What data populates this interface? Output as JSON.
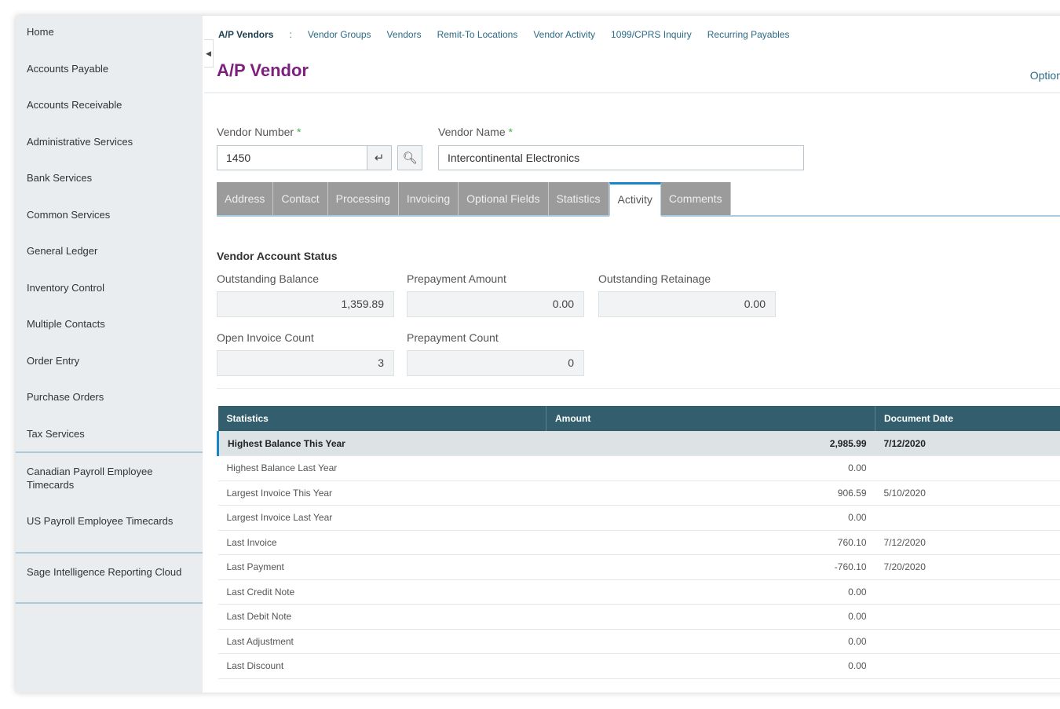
{
  "sidebar": {
    "items": [
      "Home",
      "Accounts Payable",
      "Accounts Receivable",
      "Administrative Services",
      "Bank Services",
      "Common Services",
      "General Ledger",
      "Inventory Control",
      "Multiple Contacts",
      "Order Entry",
      "Purchase Orders",
      "Tax Services",
      "Canadian Payroll Employee Timecards",
      "US Payroll Employee Timecards",
      "Sage Intelligence Reporting Cloud"
    ]
  },
  "breadcrumb": {
    "current": "A/P Vendors",
    "sep": ":",
    "links": [
      "Vendor Groups",
      "Vendors",
      "Remit-To Locations",
      "Vendor Activity",
      "1099/CPRS Inquiry",
      "Recurring Payables"
    ]
  },
  "header": {
    "title": "A/P Vendor",
    "options": "Options"
  },
  "form": {
    "vendor_number_label": "Vendor Number",
    "vendor_number": "1450",
    "vendor_name_label": "Vendor Name",
    "vendor_name": "Intercontinental Electronics",
    "required": "*"
  },
  "tabs": [
    "Address",
    "Contact",
    "Processing",
    "Invoicing",
    "Optional Fields",
    "Statistics",
    "Activity",
    "Comments"
  ],
  "status": {
    "title": "Vendor Account Status",
    "outstanding_balance_label": "Outstanding Balance",
    "outstanding_balance": "1,359.89",
    "prepayment_amount_label": "Prepayment Amount",
    "prepayment_amount": "0.00",
    "outstanding_retainage_label": "Outstanding Retainage",
    "outstanding_retainage": "0.00",
    "open_invoice_count_label": "Open Invoice Count",
    "open_invoice_count": "3",
    "prepayment_count_label": "Prepayment Count",
    "prepayment_count": "0"
  },
  "table": {
    "headers": [
      "Statistics",
      "Amount",
      "Document Date"
    ],
    "rows": [
      [
        "Highest Balance This Year",
        "2,985.99",
        "7/12/2020"
      ],
      [
        "Highest Balance Last Year",
        "0.00",
        ""
      ],
      [
        "Largest Invoice This Year",
        "906.59",
        "5/10/2020"
      ],
      [
        "Largest Invoice Last Year",
        "0.00",
        ""
      ],
      [
        "Last Invoice",
        "760.10",
        "7/12/2020"
      ],
      [
        "Last Payment",
        "-760.10",
        "7/20/2020"
      ],
      [
        "Last Credit Note",
        "0.00",
        ""
      ],
      [
        "Last Debit Note",
        "0.00",
        ""
      ],
      [
        "Last Adjustment",
        "0.00",
        ""
      ],
      [
        "Last Discount",
        "0.00",
        ""
      ]
    ]
  }
}
